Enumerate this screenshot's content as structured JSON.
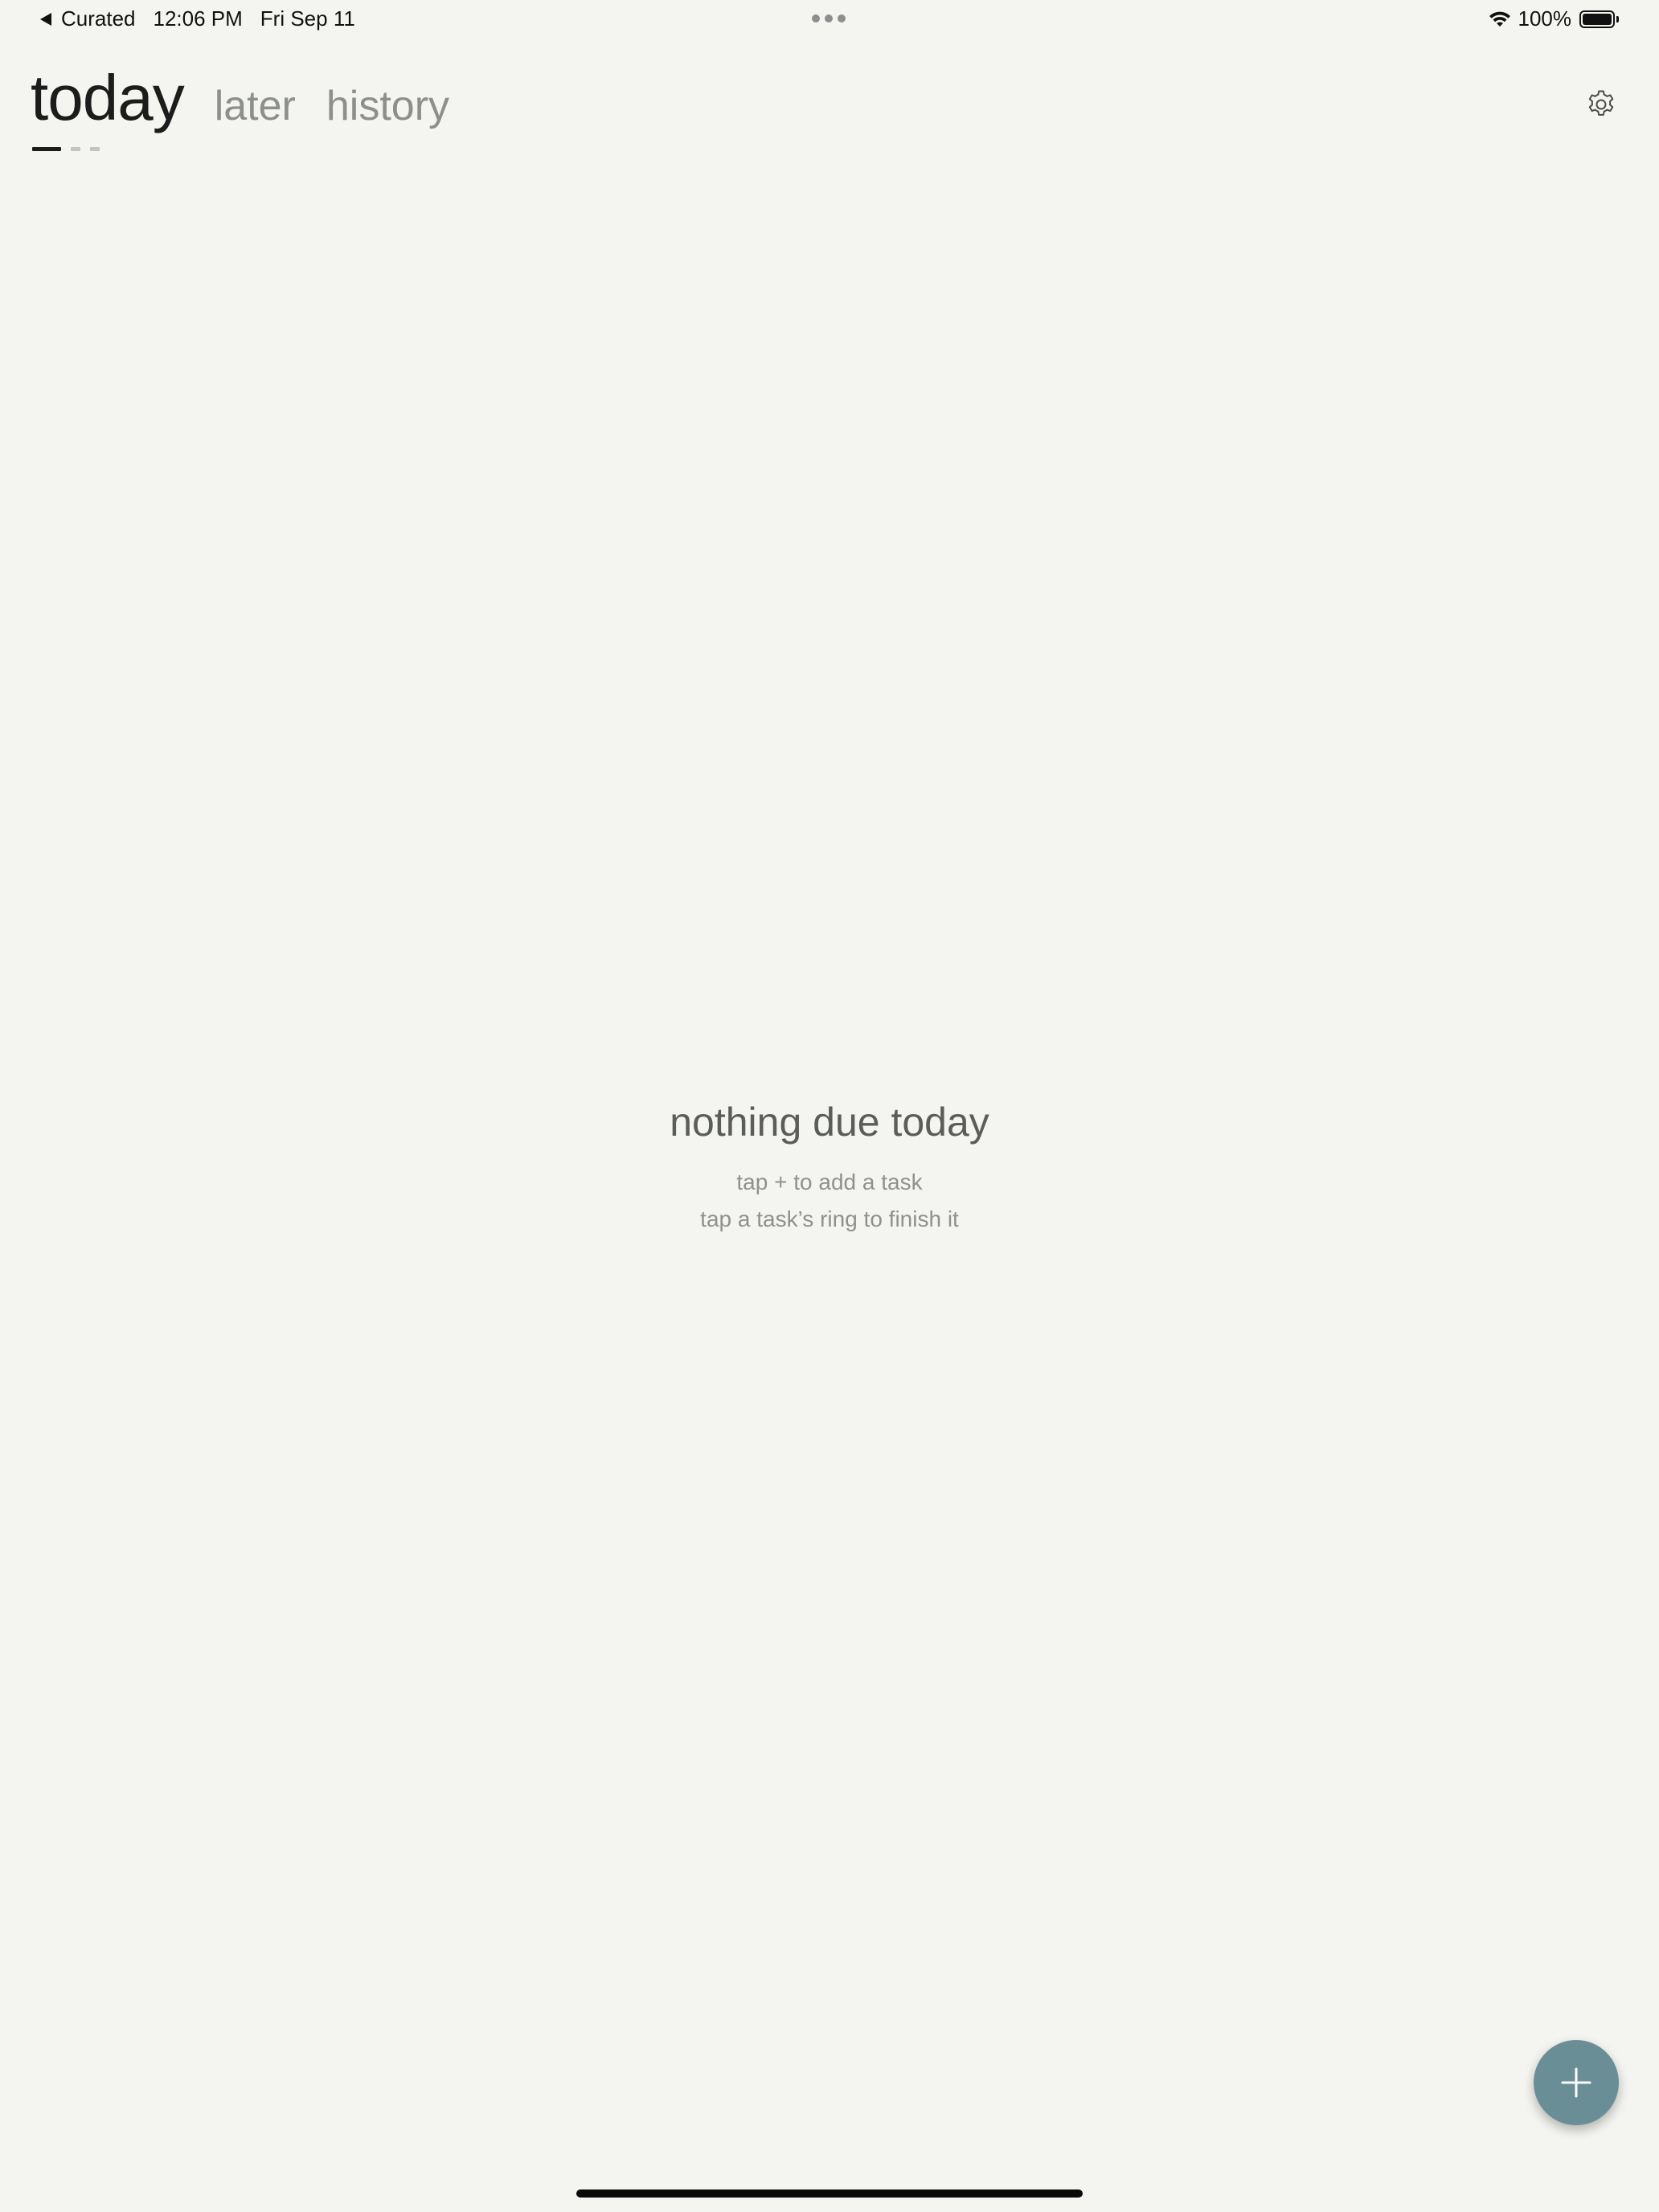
{
  "status_bar": {
    "back_app": "Curated",
    "time": "12:06 PM",
    "date": "Fri Sep 11",
    "battery_percent": "100%",
    "battery_level": 1.0,
    "icons": [
      "back-arrow-icon",
      "more-dots-icon",
      "wifi-icon",
      "battery-icon"
    ]
  },
  "tabs": [
    {
      "label": "today",
      "active": true
    },
    {
      "label": "later",
      "active": false
    },
    {
      "label": "history",
      "active": false
    }
  ],
  "page_indicator": {
    "count": 3,
    "active_index": 0
  },
  "settings": {
    "icon": "gear-icon"
  },
  "empty_state": {
    "title": "nothing due today",
    "hint_1": "tap + to add a task",
    "hint_2": "tap a task’s ring to finish it"
  },
  "fab": {
    "icon": "plus-icon"
  },
  "colors": {
    "background": "#f4f5f0",
    "fab": "#6a8e96",
    "active_tab": "#1c1c1c",
    "inactive_tab": "#8d8f8b"
  }
}
